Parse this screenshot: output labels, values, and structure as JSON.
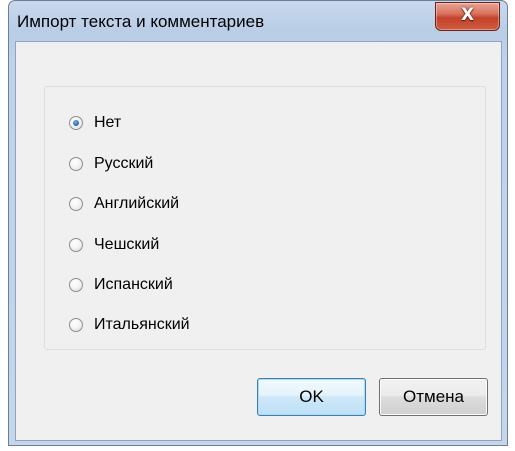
{
  "dialog": {
    "title": "Импорт текста и комментариев",
    "close_label": "X"
  },
  "languages": {
    "selected": "Нет",
    "options": [
      "Нет",
      "Русский",
      "Английский",
      "Чешский",
      "Испанский",
      "Итальянский"
    ]
  },
  "buttons": {
    "ok_label": "OK",
    "cancel_label": "Отмена"
  },
  "colors": {
    "title_bar": "#bfd2ea",
    "close_button": "#c3432b",
    "client_background": "#f0f0f0",
    "default_button_border": "#3c7fb1",
    "radio_dot": "#2a6fc0"
  },
  "icons": {
    "close": "close-icon"
  }
}
